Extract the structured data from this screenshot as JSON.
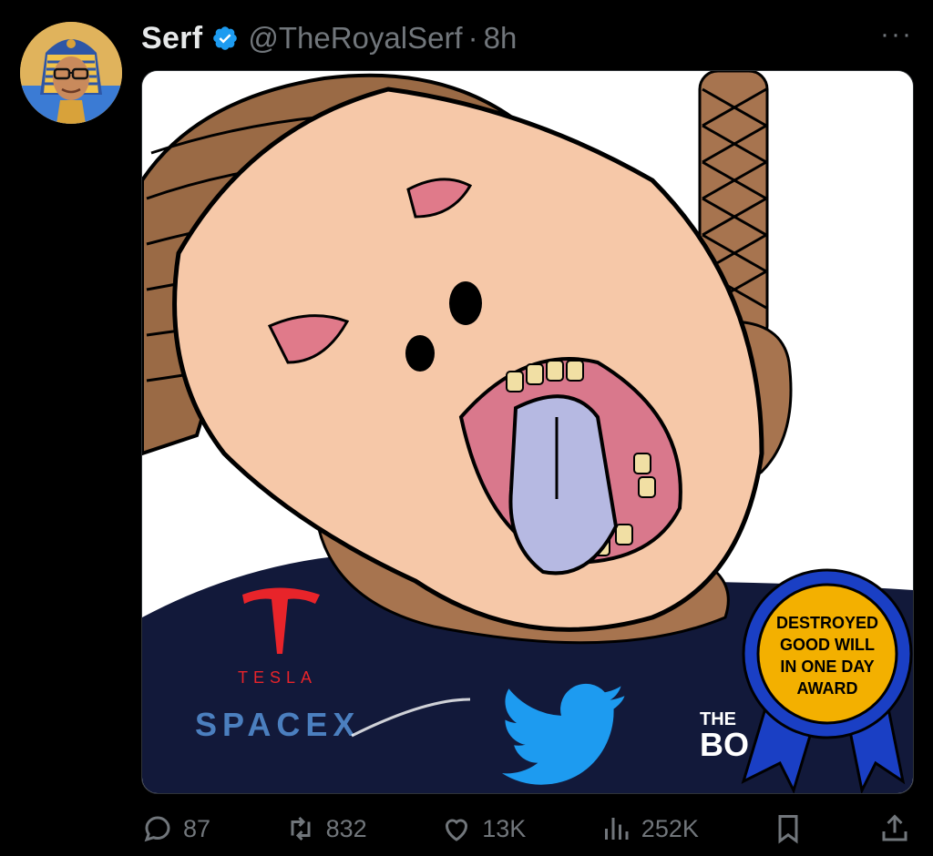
{
  "author": {
    "display_name": "Serf",
    "handle": "@TheRoyalSerf",
    "separator": "·",
    "time": "8h",
    "verified": true,
    "avatar_icon": "pharaoh-avatar"
  },
  "menu": {
    "more_icon": "more-dots-icon",
    "label": "···"
  },
  "media": {
    "image_description_icon": "meme-illustration",
    "tesla_logo_text": "TESLA",
    "spacex_logo_text": "SPACEX",
    "twitter_logo_icon": "twitter-bird-icon",
    "boeing_logo_text": "THE BOEING COMPANY",
    "award_badge": {
      "line1": "DESTROYED",
      "line2": "GOOD WILL",
      "line3": "IN ONE DAY",
      "line4": "AWARD"
    }
  },
  "actions": {
    "reply_count": "87",
    "retweet_count": "832",
    "like_count": "13K",
    "views_count": "252K"
  },
  "colors": {
    "background": "#000000",
    "text_primary": "#e7e9ea",
    "text_secondary": "#71767b",
    "verified_blue": "#1d9bf0"
  }
}
